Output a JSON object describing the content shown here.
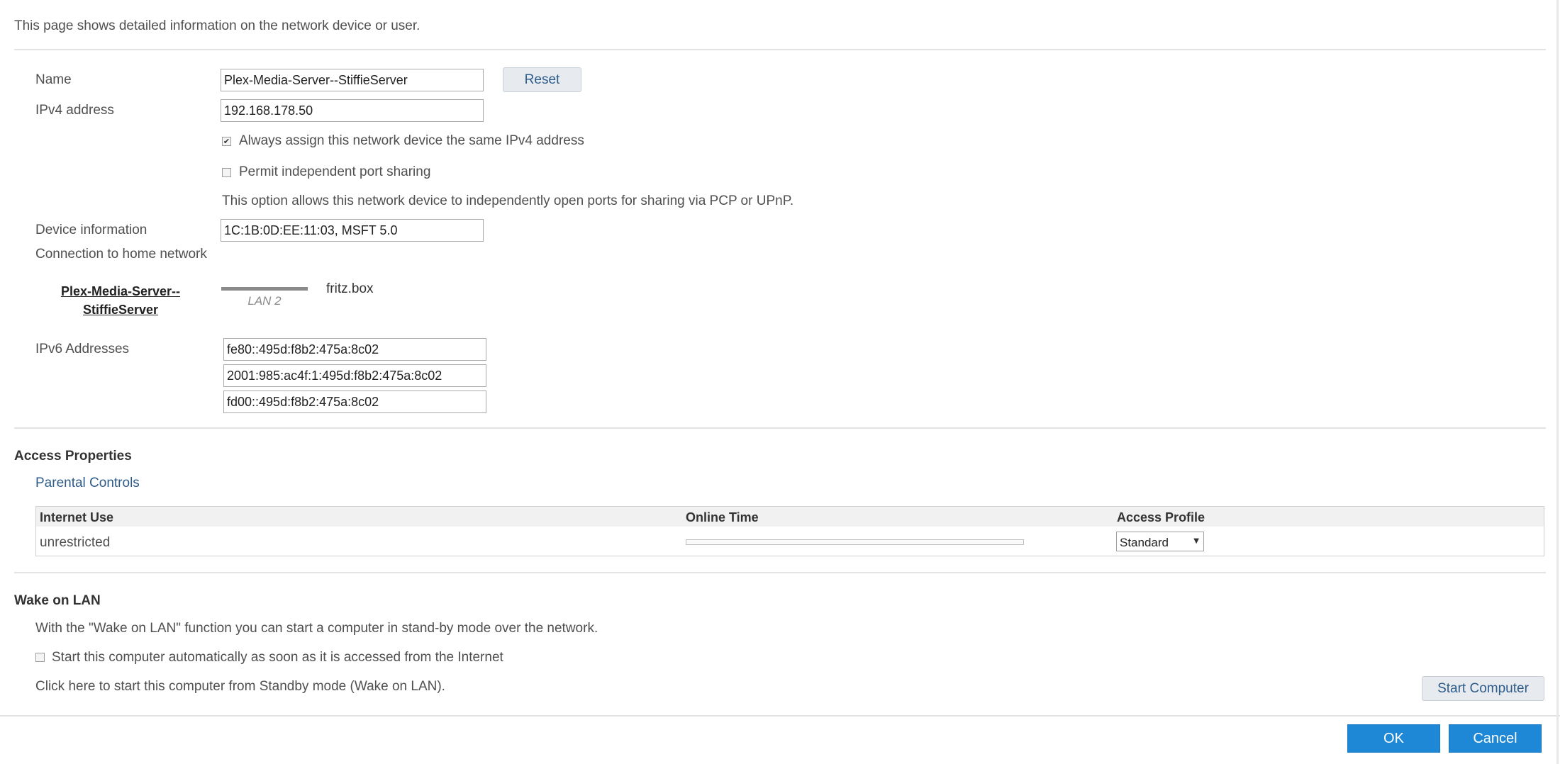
{
  "intro": "This page shows detailed information on the network device or user.",
  "device": {
    "name_label": "Name",
    "name_value": "Plex-Media-Server--StiffieServer",
    "reset_label": "Reset",
    "ipv4_label": "IPv4 address",
    "ipv4_value": "192.168.178.50",
    "same_ip_label": "Always assign this network device the same IPv4 address",
    "same_ip_checked": true,
    "port_sharing_label": "Permit independent port sharing",
    "port_sharing_checked": false,
    "port_sharing_note": "This option allows this network device to independently open ports for sharing via PCP or UPnP.",
    "info_label": "Device information",
    "info_value": "1C:1B:0D:EE:11:03, MSFT 5.0",
    "connection_label": "Connection to home network",
    "connection": {
      "device_line1": "Plex-Media-Server--",
      "device_line2": "StiffieServer",
      "link_label": "LAN 2",
      "router": "fritz.box"
    },
    "ipv6_label": "IPv6 Addresses",
    "ipv6": [
      "fe80::495d:f8b2:475a:8c02",
      "2001:985:ac4f:1:495d:f8b2:475a:8c02",
      "fd00::495d:f8b2:475a:8c02"
    ]
  },
  "access": {
    "heading": "Access Properties",
    "parental_link": "Parental Controls",
    "columns": [
      "Internet Use",
      "Online Time",
      "Access Profile"
    ],
    "row": {
      "internet_use": "unrestricted",
      "online_time_fraction": 0,
      "profile": "Standard"
    },
    "profile_options": [
      "Standard"
    ]
  },
  "wol": {
    "heading": "Wake on LAN",
    "desc": "With the \"Wake on LAN\" function you can start a computer in stand-by mode over the network.",
    "auto_label": "Start this computer automatically as soon as it is accessed from the Internet",
    "auto_checked": false,
    "click_text": "Click here to start this computer from Standby mode (Wake on LAN).",
    "start_button": "Start Computer"
  },
  "footer": {
    "ok": "OK",
    "cancel": "Cancel"
  },
  "colors": {
    "primary_button": "#1f88d6",
    "link": "#2e5c8a"
  }
}
